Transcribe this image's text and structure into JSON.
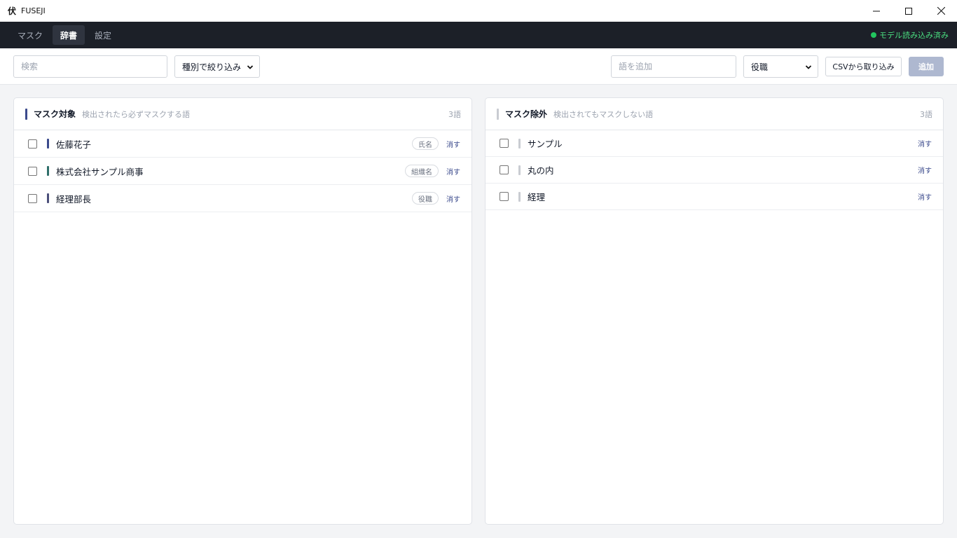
{
  "window": {
    "logo_glyph": "伏",
    "title": "FUSEJI"
  },
  "nav": {
    "tabs": [
      {
        "label": "マスク",
        "active": false
      },
      {
        "label": "辞書",
        "active": true
      },
      {
        "label": "設定",
        "active": false
      }
    ],
    "status": "モデル読み込み済み"
  },
  "toolbar": {
    "search_placeholder": "検索",
    "filter_label": "種別で絞り込み",
    "add_word_placeholder": "語を追加",
    "category_selected": "役職",
    "csv_label": "CSVから取り込み",
    "add_label": "追加"
  },
  "colors": {
    "person": "#3b4a8c",
    "organization": "#2f6f6a",
    "title": "#4b4f7a",
    "exclude": "#c9ccd2",
    "mask_header": "#3b4a8c",
    "exclude_header": "#c9ccd2"
  },
  "mask_panel": {
    "title": "マスク対象",
    "description": "検出されたら必ずマスクする語",
    "count": "3語",
    "items": [
      {
        "text": "佐藤花子",
        "tag": "氏名",
        "delete": "消す"
      },
      {
        "text": "株式会社サンプル商事",
        "tag": "組織名",
        "delete": "消す"
      },
      {
        "text": "経理部長",
        "tag": "役職",
        "delete": "消す"
      }
    ]
  },
  "exclude_panel": {
    "title": "マスク除外",
    "description": "検出されてもマスクしない語",
    "count": "3語",
    "items": [
      {
        "text": "サンプル",
        "delete": "消す"
      },
      {
        "text": "丸の内",
        "delete": "消す"
      },
      {
        "text": "経理",
        "delete": "消す"
      }
    ]
  }
}
